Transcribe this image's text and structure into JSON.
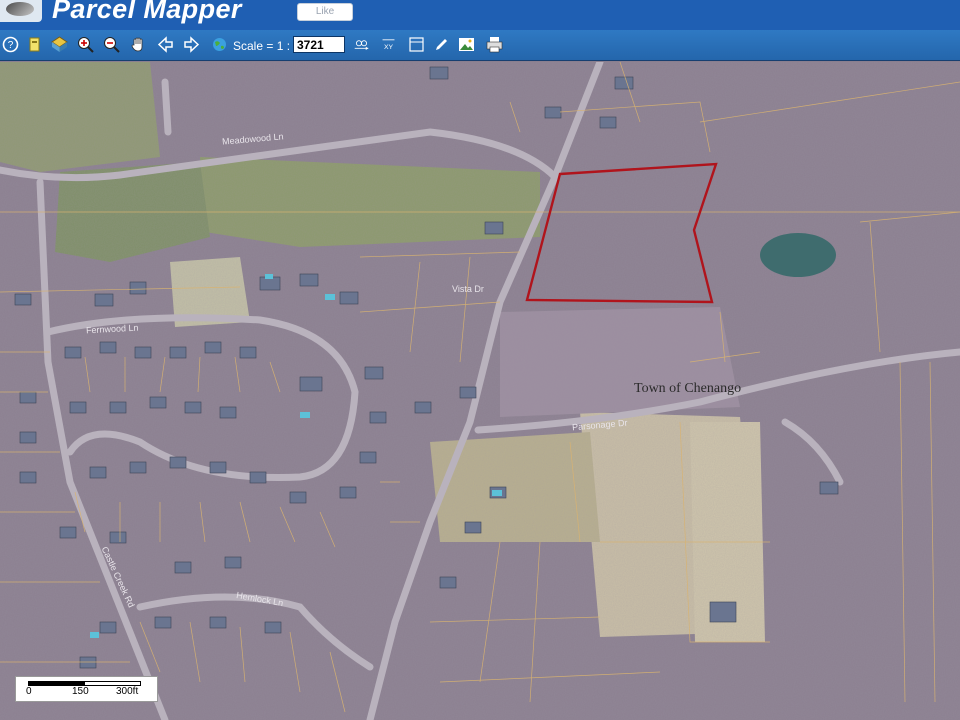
{
  "header": {
    "title": "Parcel Mapper",
    "like_label": "Like"
  },
  "toolbar": {
    "buttons": [
      "help-icon",
      "layers-icon",
      "full-extent-icon",
      "zoom-in-icon",
      "zoom-out-icon",
      "pan-hand-icon",
      "back-icon",
      "forward-icon",
      "globe-icon"
    ],
    "scale_label": "Scale = 1 :",
    "scale_value": "3721",
    "right_buttons": [
      "coordinates-icon",
      "xy-icon",
      "measure-pencil-icon",
      "photo-icon",
      "report-icon",
      "print-icon"
    ]
  },
  "map": {
    "town_label": "Town of Chenango",
    "streets": [
      "Meadowood Ln",
      "Fernwood Ln",
      "Vista Dr",
      "Hemlock Ln",
      "Castle Creek Rd",
      "Parsonage Dr"
    ],
    "highlight_color": "#b0141c"
  },
  "scalebar": {
    "ticks": [
      "0",
      "150",
      "300ft"
    ]
  },
  "colors": {
    "header_bg": "#1f5fb3",
    "toolbar_bg": "#2a6fba",
    "parcel_line": "#d9b370"
  }
}
